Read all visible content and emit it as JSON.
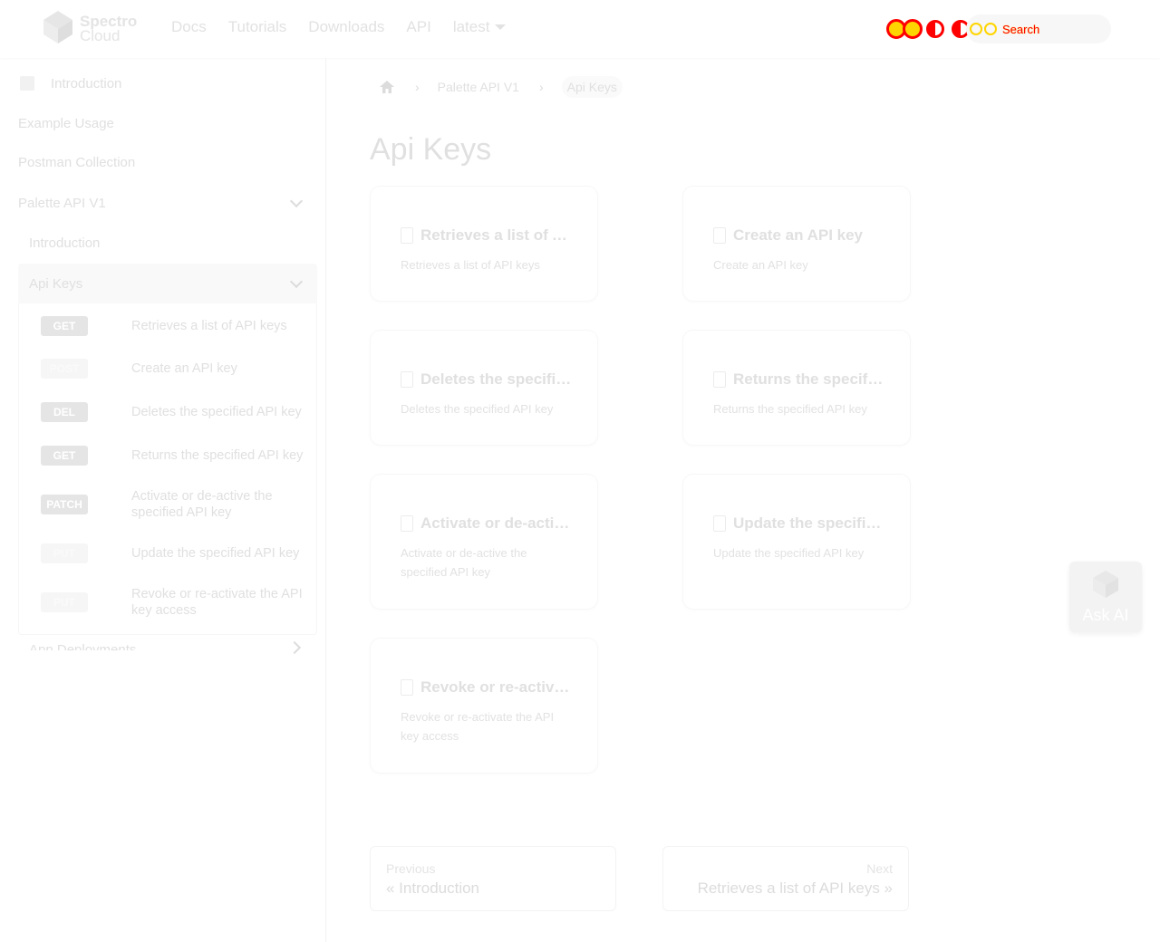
{
  "navbar": {
    "brand_line1": "Spectro",
    "brand_line2": "Cloud",
    "links": [
      "Docs",
      "Tutorials",
      "Downloads",
      "API"
    ],
    "version_label": "latest",
    "search_placeholder": "Search"
  },
  "sidebar": {
    "top_items": [
      "Introduction",
      "Example Usage",
      "Postman Collection",
      "Palette API V1"
    ],
    "sub_intro": "Introduction",
    "group_title": "Api Keys",
    "endpoints": [
      {
        "method": "GET",
        "label": "Retrieves a list of API keys"
      },
      {
        "method": "POST",
        "label": "Create an API key"
      },
      {
        "method": "DEL",
        "label": "Deletes the specified API key"
      },
      {
        "method": "GET",
        "label": "Returns the specified API key"
      },
      {
        "method": "PATCH",
        "label": "Activate or de-active the specified API key"
      },
      {
        "method": "PUT",
        "label": "Update the specified API key"
      },
      {
        "method": "PUT",
        "label": "Revoke or re-activate the API key access"
      }
    ],
    "next_group": "App Deployments"
  },
  "breadcrumb": {
    "level1": "Palette API V1",
    "level2": "Api Keys"
  },
  "page": {
    "title": "Api Keys"
  },
  "cards": [
    {
      "title": "Retrieves a list of API keys",
      "desc": "Retrieves a list of API keys"
    },
    {
      "title": "Create an API key",
      "desc": "Create an API key"
    },
    {
      "title": "Deletes the specified API key",
      "desc": "Deletes the specified API key"
    },
    {
      "title": "Returns the specified API key",
      "desc": "Returns the specified API key"
    },
    {
      "title": "Activate or de-active the specified API key",
      "desc": "Activate or de-active the specified API key"
    },
    {
      "title": "Update the specified API key",
      "desc": "Update the specified API key"
    },
    {
      "title": "Revoke or re-activate the API key access",
      "desc": "Revoke or re-activate the API key access"
    }
  ],
  "pager": {
    "prev_sub": "Previous",
    "prev_label": "« Introduction",
    "next_sub": "Next",
    "next_label": "Retrieves a list of API keys »"
  },
  "ask_ai": {
    "label": "Ask AI"
  },
  "icons": {
    "brand": "spectro-cloud-logo",
    "home": "home-icon",
    "doc": "document-icon"
  }
}
